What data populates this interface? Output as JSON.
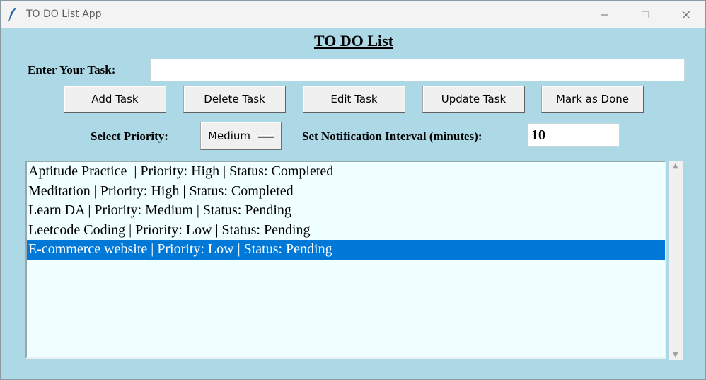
{
  "window": {
    "title": "TO DO List App",
    "minimize_glyph": "—",
    "maximize_glyph": "☐",
    "close_glyph": "✕"
  },
  "heading": "TO DO List",
  "task_entry": {
    "label": "Enter Your Task:",
    "value": ""
  },
  "buttons": {
    "add": "Add Task",
    "delete": "Delete Task",
    "edit": "Edit Task",
    "update": "Update Task",
    "done": "Mark as Done"
  },
  "priority": {
    "label": "Select Priority:",
    "selected": "Medium"
  },
  "notification": {
    "label": "Set Notification Interval (minutes):",
    "value": "10"
  },
  "tasks": [
    {
      "text": "Aptitude Practice  | Priority: High | Status: Completed",
      "selected": false
    },
    {
      "text": "Meditation | Priority: High | Status: Completed",
      "selected": false
    },
    {
      "text": "Learn DA | Priority: Medium | Status: Pending",
      "selected": false
    },
    {
      "text": "Leetcode Coding | Priority: Low | Status: Pending",
      "selected": false
    },
    {
      "text": "E-commerce website | Priority: Low | Status: Pending",
      "selected": true
    }
  ],
  "scrollbar": {
    "up_glyph": "▲",
    "down_glyph": "▼"
  },
  "colors": {
    "background": "#add8e6",
    "listbox_bg": "#f0ffff",
    "selection": "#0078d7"
  }
}
